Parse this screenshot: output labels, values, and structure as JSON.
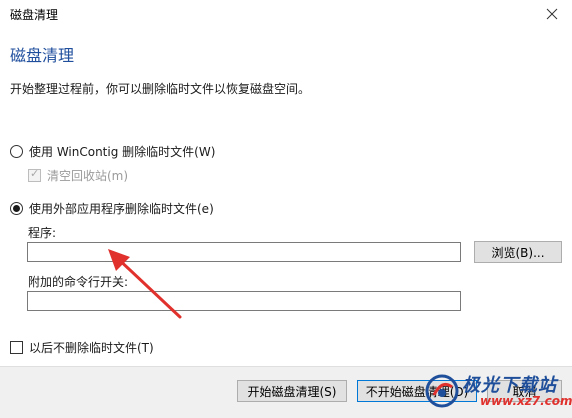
{
  "window": {
    "title": "磁盘清理"
  },
  "dialog": {
    "heading": "磁盘清理",
    "description": "开始整理过程前，你可以删除临时文件以恢复磁盘空间。",
    "option_wincontig": "使用 WinContig 删除临时文件(W)",
    "option_recycle": "清空回收站(m)",
    "option_external": "使用外部应用程序删除临时文件(e)",
    "program_label": "程序:",
    "program_value": "",
    "browse_button": "浏览(B)...",
    "args_label": "附加的命令行开关:",
    "args_value": "",
    "dont_delete_checkbox": "以后不删除临时文件(T)"
  },
  "footer": {
    "start_button": "开始磁盘清理(S)",
    "no_start_button": "不开始磁盘清理(D)",
    "cancel_button": "取消"
  },
  "watermark": {
    "text": "极光下载站",
    "url": "www.xz7.com"
  },
  "colors": {
    "heading": "#1f4e9c",
    "arrow": "#e0312d",
    "default_button_border": "#0078d7"
  },
  "icons": {
    "close": "close-icon",
    "arrow": "red-arrow-annotation"
  }
}
